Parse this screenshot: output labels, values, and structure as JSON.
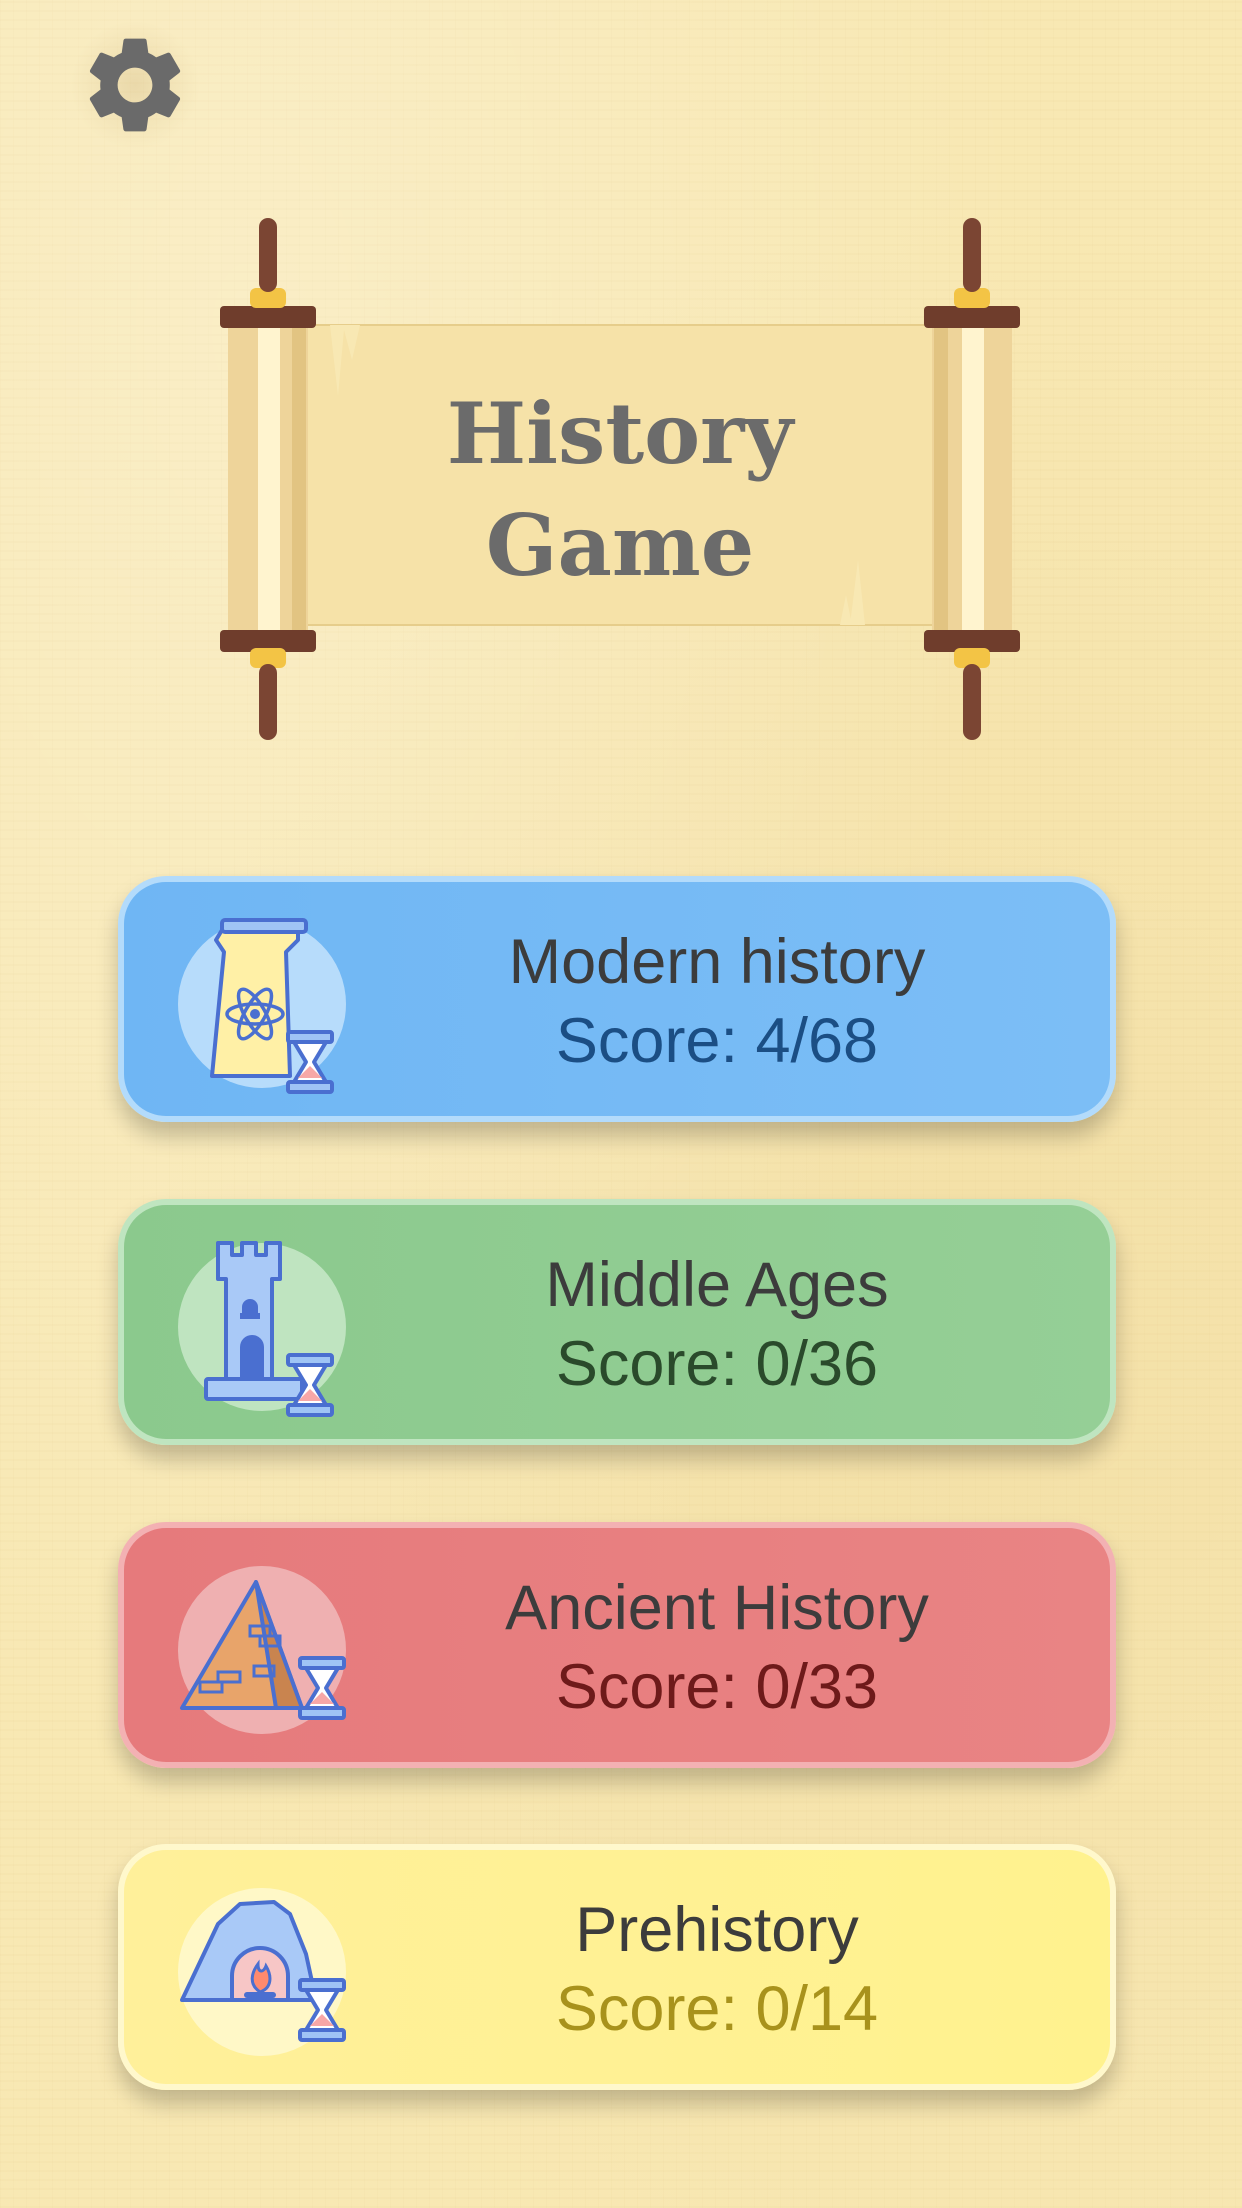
{
  "app": {
    "title_line1": "History",
    "title_line2": "Game"
  },
  "settings": {
    "icon": "gear-icon"
  },
  "categories": [
    {
      "name": "Modern history",
      "score": "Score: 4/68",
      "icon": "atom-tower-hourglass-icon",
      "color": "#79bbf5"
    },
    {
      "name": "Middle Ages",
      "score": "Score: 0/36",
      "icon": "castle-tower-hourglass-icon",
      "color": "#90cc91"
    },
    {
      "name": "Ancient History",
      "score": "Score: 0/33",
      "icon": "pyramid-hourglass-icon",
      "color": "#e78081"
    },
    {
      "name": "Prehistory",
      "score": "Score: 0/14",
      "icon": "cave-fire-hourglass-icon",
      "color": "#fff195"
    }
  ]
}
